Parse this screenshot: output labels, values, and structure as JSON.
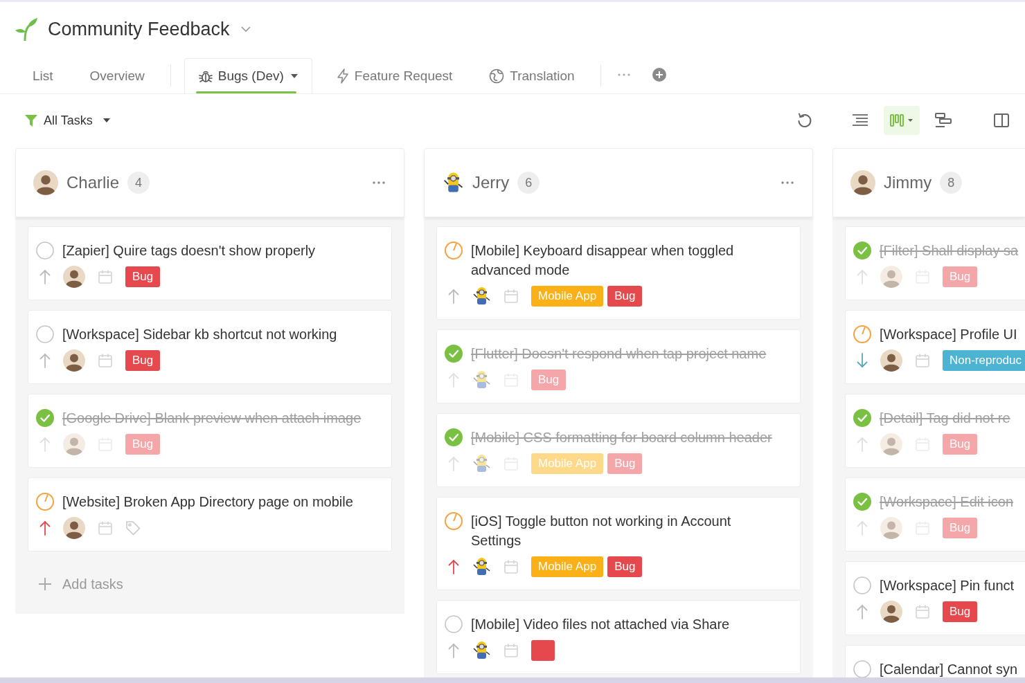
{
  "project": {
    "title": "Community Feedback"
  },
  "tabs": [
    {
      "label": "List",
      "kind": "view",
      "selected": false
    },
    {
      "label": "Overview",
      "kind": "view",
      "selected": false
    },
    {
      "label": "Bugs (Dev)",
      "kind": "filter",
      "selected": true
    },
    {
      "label": "Feature Request",
      "kind": "filter",
      "selected": false
    },
    {
      "label": "Translation",
      "kind": "filter",
      "selected": false
    }
  ],
  "toolbar": {
    "filter": {
      "label": "All Tasks"
    },
    "views": [
      {
        "selected": false
      },
      {
        "selected": true
      },
      {
        "selected": false
      }
    ]
  },
  "columns": [
    {
      "name": "Charlie",
      "count": "4",
      "kind": "photo",
      "has_menu": true,
      "add_label": "Add tasks",
      "tasks": [
        {
          "title": "[Zapier] Quire tags doesn't show properly",
          "kind": "open",
          "meta": {
            "high_priority": false,
            "low_priority": false,
            "tags": [
              {
                "label": "Bug",
                "color": "#e5484d"
              }
            ]
          }
        },
        {
          "title": "[Workspace] Sidebar kb shortcut not working",
          "kind": "open",
          "meta": {
            "high_priority": false,
            "low_priority": false,
            "tags": [
              {
                "label": "Bug",
                "color": "#e5484d"
              }
            ]
          }
        },
        {
          "title": "[Google Drive] Blank preview when attach image",
          "kind": "done",
          "meta": {
            "high_priority": false,
            "low_priority": false,
            "tags": [
              {
                "label": "Bug",
                "color": "#f5a6a9"
              }
            ]
          }
        },
        {
          "title": "[Website] Broken App Directory page on mobile",
          "kind": "started",
          "meta": {
            "high_priority": true,
            "low_priority": false
          }
        }
      ]
    },
    {
      "name": "Jerry",
      "count": "6",
      "kind": "cartoon",
      "has_menu": true,
      "tasks": [
        {
          "title": "[Mobile] Keyboard disappear when toggled advanced mode",
          "kind": "started",
          "meta": {
            "high_priority": false,
            "low_priority": false,
            "tags": [
              {
                "label": "Mobile App",
                "color": "#fcb017"
              },
              {
                "label": "Bug",
                "color": "#e5484d"
              }
            ]
          }
        },
        {
          "title": "[Flutter] Doesn't respond when tap project name",
          "kind": "done",
          "meta": {
            "high_priority": false,
            "low_priority": false,
            "tags": [
              {
                "label": "Bug",
                "color": "#f5a6a9"
              }
            ]
          }
        },
        {
          "title": "[Mobile] CSS formatting for board column header",
          "kind": "done",
          "meta": {
            "high_priority": false,
            "low_priority": false,
            "tags": [
              {
                "label": "Mobile App",
                "color": "#fed98a"
              },
              {
                "label": "Bug",
                "color": "#f5a6a9"
              }
            ]
          }
        },
        {
          "title": "[iOS] Toggle button not working in Account Settings",
          "kind": "started",
          "meta": {
            "high_priority": true,
            "low_priority": false,
            "tags": [
              {
                "label": "Mobile App",
                "color": "#fcb017"
              },
              {
                "label": "Bug",
                "color": "#e5484d"
              }
            ]
          }
        },
        {
          "title": "[Mobile] Video files not attached via Share",
          "kind": "open",
          "meta": {
            "high_priority": false,
            "low_priority": false,
            "tags": [
              {
                "color": "#e5484d"
              }
            ]
          }
        }
      ]
    },
    {
      "name": "Jimmy",
      "count": "8",
      "kind": "photo",
      "has_menu": false,
      "tasks": [
        {
          "title": "[Filter] Shall display sa",
          "kind": "done",
          "meta": {
            "high_priority": false,
            "low_priority": false,
            "tags": [
              {
                "label": "Bug",
                "color": "#f5a6a9"
              }
            ]
          }
        },
        {
          "title": "[Workspace] Profile UI",
          "kind": "started",
          "meta": {
            "high_priority": false,
            "low_priority": true,
            "tags": [
              {
                "label": "Non-reproduc",
                "color": "#4db3d3"
              }
            ]
          }
        },
        {
          "title": "[Detail] Tag did not re",
          "kind": "done",
          "meta": {
            "high_priority": false,
            "low_priority": false,
            "tags": [
              {
                "label": "Bug",
                "color": "#f5a6a9"
              }
            ]
          }
        },
        {
          "title": "[Workspace] Edit icon",
          "kind": "done",
          "meta": {
            "high_priority": false,
            "low_priority": false,
            "tags": [
              {
                "label": "Bug",
                "color": "#f5a6a9"
              }
            ]
          }
        },
        {
          "title": "[Workspace] Pin funct",
          "kind": "open",
          "meta": {
            "high_priority": false,
            "low_priority": false,
            "tags": [
              {
                "label": "Bug",
                "color": "#e5484d"
              }
            ]
          }
        },
        {
          "title": "[Calendar] Cannot syn",
          "kind": "open"
        }
      ]
    }
  ]
}
